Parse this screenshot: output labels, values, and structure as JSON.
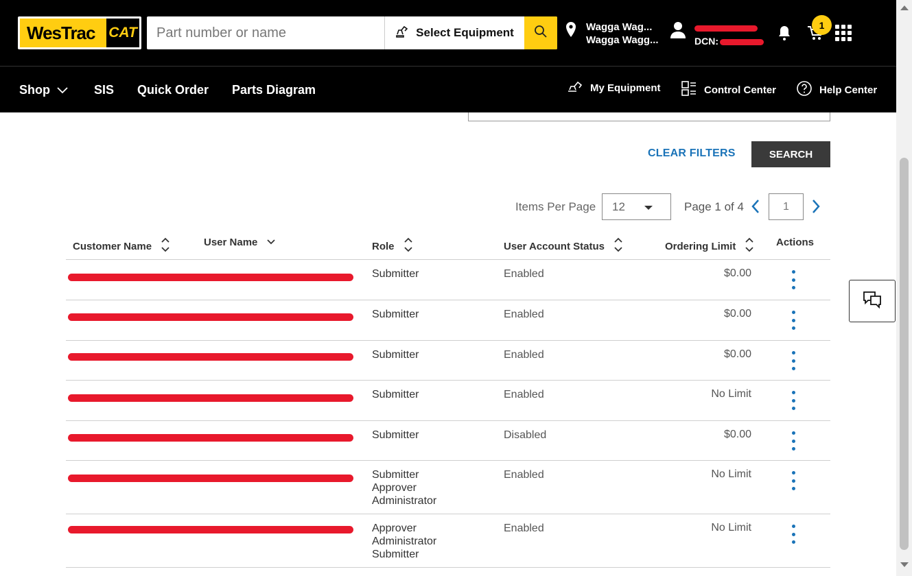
{
  "header": {
    "logo_text": "WesTrac",
    "logo_cat": "CAT",
    "search_placeholder": "Part number or name",
    "select_equipment": "Select Equipment",
    "location_line1": "Wagga Wag...",
    "location_line2": "Wagga Wagg...",
    "dcn_label": "DCN:",
    "cart_count": "1",
    "icons": [
      "search-icon",
      "excavator-icon",
      "location-pin-icon",
      "user-icon",
      "bell-icon",
      "cart-icon",
      "apps-grid-icon"
    ]
  },
  "nav": {
    "shop": "Shop",
    "sis": "SIS",
    "quick_order": "Quick Order",
    "parts_diagram": "Parts Diagram",
    "my_equipment": "My Equipment",
    "control_center": "Control Center",
    "help_center": "Help Center"
  },
  "filters": {
    "clear": "CLEAR FILTERS",
    "search": "SEARCH"
  },
  "pagination": {
    "items_per_page_label": "Items Per Page",
    "items_per_page": "12",
    "page_label": "Page 1 of 4",
    "current_page": "1"
  },
  "table": {
    "headers": {
      "customer_name": "Customer Name",
      "user_name": "User Name",
      "role": "Role",
      "status": "User Account Status",
      "ordering_limit": "Ordering Limit",
      "actions": "Actions"
    },
    "rows": [
      {
        "role": [
          "Submitter"
        ],
        "status": "Enabled",
        "limit": "$0.00"
      },
      {
        "role": [
          "Submitter"
        ],
        "status": "Enabled",
        "limit": "$0.00"
      },
      {
        "role": [
          "Submitter"
        ],
        "status": "Enabled",
        "limit": "$0.00"
      },
      {
        "role": [
          "Submitter"
        ],
        "status": "Enabled",
        "limit": "No Limit"
      },
      {
        "role": [
          "Submitter"
        ],
        "status": "Disabled",
        "limit": "$0.00"
      },
      {
        "role": [
          "Submitter",
          "Approver",
          "Administrator"
        ],
        "status": "Enabled",
        "limit": "No Limit"
      },
      {
        "role": [
          "Approver",
          "Administrator",
          "Submitter"
        ],
        "status": "Enabled",
        "limit": "No Limit"
      }
    ]
  },
  "colors": {
    "brand_yellow": "#ffcd11",
    "link_blue": "#1a73b8",
    "redaction_red": "#e8192c"
  }
}
